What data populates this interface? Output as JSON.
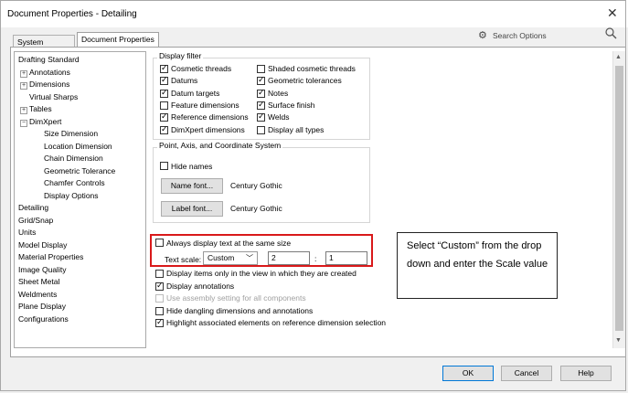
{
  "window": {
    "title": "Document Properties - Detailing",
    "close_glyph": "✕"
  },
  "tabs": [
    {
      "label": "System Options",
      "active": false
    },
    {
      "label": "Document Properties",
      "active": true
    }
  ],
  "search": {
    "placeholder": "Search Options",
    "gear_icon": "gear-icon",
    "search_icon": "search-icon"
  },
  "tree": {
    "items": [
      {
        "label": "Drafting Standard",
        "level": 0,
        "expander": ""
      },
      {
        "label": "Annotations",
        "level": 1,
        "expander": "+"
      },
      {
        "label": "Dimensions",
        "level": 1,
        "expander": "+"
      },
      {
        "label": "Virtual Sharps",
        "level": 1,
        "expander": ""
      },
      {
        "label": "Tables",
        "level": 1,
        "expander": "+"
      },
      {
        "label": "DimXpert",
        "level": 1,
        "expander": "−"
      },
      {
        "label": "Size Dimension",
        "level": 2,
        "expander": ""
      },
      {
        "label": "Location Dimension",
        "level": 2,
        "expander": ""
      },
      {
        "label": "Chain Dimension",
        "level": 2,
        "expander": ""
      },
      {
        "label": "Geometric Tolerance",
        "level": 2,
        "expander": ""
      },
      {
        "label": "Chamfer Controls",
        "level": 2,
        "expander": ""
      },
      {
        "label": "Display Options",
        "level": 2,
        "expander": ""
      },
      {
        "label": "Detailing",
        "level": 0,
        "expander": ""
      },
      {
        "label": "Grid/Snap",
        "level": 0,
        "expander": ""
      },
      {
        "label": "Units",
        "level": 0,
        "expander": ""
      },
      {
        "label": "Model Display",
        "level": 0,
        "expander": ""
      },
      {
        "label": "Material Properties",
        "level": 0,
        "expander": ""
      },
      {
        "label": "Image Quality",
        "level": 0,
        "expander": ""
      },
      {
        "label": "Sheet Metal",
        "level": 0,
        "expander": ""
      },
      {
        "label": "Weldments",
        "level": 0,
        "expander": ""
      },
      {
        "label": "Plane Display",
        "level": 0,
        "expander": ""
      },
      {
        "label": "Configurations",
        "level": 0,
        "expander": ""
      }
    ]
  },
  "display_filter": {
    "label": "Display filter",
    "left": [
      {
        "label": "Cosmetic threads",
        "checked": true
      },
      {
        "label": "Datums",
        "checked": true
      },
      {
        "label": "Datum targets",
        "checked": true
      },
      {
        "label": "Feature dimensions",
        "checked": false
      },
      {
        "label": "Reference dimensions",
        "checked": true
      },
      {
        "label": "DimXpert dimensions",
        "checked": true
      }
    ],
    "right": [
      {
        "label": "Shaded cosmetic threads",
        "checked": false
      },
      {
        "label": "Geometric tolerances",
        "checked": true
      },
      {
        "label": "Notes",
        "checked": true
      },
      {
        "label": "Surface finish",
        "checked": true
      },
      {
        "label": "Welds",
        "checked": true
      },
      {
        "label": "Display all types",
        "checked": false
      }
    ]
  },
  "point_axis": {
    "label": "Point, Axis, and Coordinate System",
    "hide_names": {
      "label": "Hide names",
      "checked": false
    },
    "name_font_button": "Name font...",
    "name_font_value": "Century Gothic",
    "label_font_button": "Label font...",
    "label_font_value": "Century Gothic"
  },
  "text_scale": {
    "always_same_size": {
      "label": "Always display text at the same size",
      "checked": false
    },
    "label": "Text scale:",
    "mode": "Custom",
    "numerator": "2",
    "separator": ":",
    "denominator": "1"
  },
  "options": [
    {
      "label": "Display items only in the view in which they are created",
      "checked": false,
      "disabled": false,
      "indent": false
    },
    {
      "label": "Display annotations",
      "checked": true,
      "disabled": false,
      "indent": false
    },
    {
      "label": "Use assembly setting for all components",
      "checked": false,
      "disabled": true,
      "indent": true
    },
    {
      "label": "Hide dangling dimensions and annotations",
      "checked": false,
      "disabled": false,
      "indent": false
    },
    {
      "label": "Highlight associated elements on reference dimension selection",
      "checked": true,
      "disabled": false,
      "indent": false
    }
  ],
  "callout": {
    "text": "Select “Custom” from the drop down and enter the Scale value"
  },
  "footer": {
    "ok": "OK",
    "cancel": "Cancel",
    "help": "Help"
  },
  "colors": {
    "highlight": "#d9191a",
    "ok_border": "#0078d7"
  }
}
